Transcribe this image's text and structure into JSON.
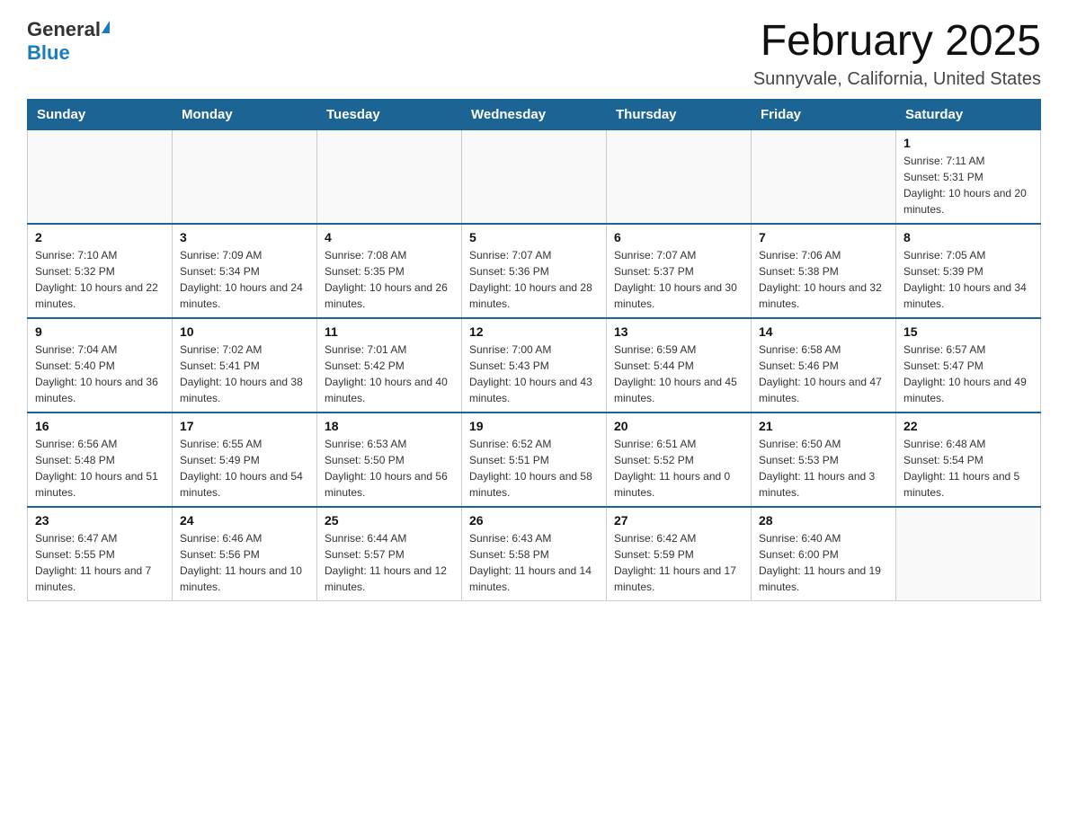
{
  "header": {
    "logo_general": "General",
    "logo_blue": "Blue",
    "month_title": "February 2025",
    "location": "Sunnyvale, California, United States"
  },
  "days_of_week": [
    "Sunday",
    "Monday",
    "Tuesday",
    "Wednesday",
    "Thursday",
    "Friday",
    "Saturday"
  ],
  "weeks": [
    [
      {
        "day": "",
        "info": ""
      },
      {
        "day": "",
        "info": ""
      },
      {
        "day": "",
        "info": ""
      },
      {
        "day": "",
        "info": ""
      },
      {
        "day": "",
        "info": ""
      },
      {
        "day": "",
        "info": ""
      },
      {
        "day": "1",
        "info": "Sunrise: 7:11 AM\nSunset: 5:31 PM\nDaylight: 10 hours and 20 minutes."
      }
    ],
    [
      {
        "day": "2",
        "info": "Sunrise: 7:10 AM\nSunset: 5:32 PM\nDaylight: 10 hours and 22 minutes."
      },
      {
        "day": "3",
        "info": "Sunrise: 7:09 AM\nSunset: 5:34 PM\nDaylight: 10 hours and 24 minutes."
      },
      {
        "day": "4",
        "info": "Sunrise: 7:08 AM\nSunset: 5:35 PM\nDaylight: 10 hours and 26 minutes."
      },
      {
        "day": "5",
        "info": "Sunrise: 7:07 AM\nSunset: 5:36 PM\nDaylight: 10 hours and 28 minutes."
      },
      {
        "day": "6",
        "info": "Sunrise: 7:07 AM\nSunset: 5:37 PM\nDaylight: 10 hours and 30 minutes."
      },
      {
        "day": "7",
        "info": "Sunrise: 7:06 AM\nSunset: 5:38 PM\nDaylight: 10 hours and 32 minutes."
      },
      {
        "day": "8",
        "info": "Sunrise: 7:05 AM\nSunset: 5:39 PM\nDaylight: 10 hours and 34 minutes."
      }
    ],
    [
      {
        "day": "9",
        "info": "Sunrise: 7:04 AM\nSunset: 5:40 PM\nDaylight: 10 hours and 36 minutes."
      },
      {
        "day": "10",
        "info": "Sunrise: 7:02 AM\nSunset: 5:41 PM\nDaylight: 10 hours and 38 minutes."
      },
      {
        "day": "11",
        "info": "Sunrise: 7:01 AM\nSunset: 5:42 PM\nDaylight: 10 hours and 40 minutes."
      },
      {
        "day": "12",
        "info": "Sunrise: 7:00 AM\nSunset: 5:43 PM\nDaylight: 10 hours and 43 minutes."
      },
      {
        "day": "13",
        "info": "Sunrise: 6:59 AM\nSunset: 5:44 PM\nDaylight: 10 hours and 45 minutes."
      },
      {
        "day": "14",
        "info": "Sunrise: 6:58 AM\nSunset: 5:46 PM\nDaylight: 10 hours and 47 minutes."
      },
      {
        "day": "15",
        "info": "Sunrise: 6:57 AM\nSunset: 5:47 PM\nDaylight: 10 hours and 49 minutes."
      }
    ],
    [
      {
        "day": "16",
        "info": "Sunrise: 6:56 AM\nSunset: 5:48 PM\nDaylight: 10 hours and 51 minutes."
      },
      {
        "day": "17",
        "info": "Sunrise: 6:55 AM\nSunset: 5:49 PM\nDaylight: 10 hours and 54 minutes."
      },
      {
        "day": "18",
        "info": "Sunrise: 6:53 AM\nSunset: 5:50 PM\nDaylight: 10 hours and 56 minutes."
      },
      {
        "day": "19",
        "info": "Sunrise: 6:52 AM\nSunset: 5:51 PM\nDaylight: 10 hours and 58 minutes."
      },
      {
        "day": "20",
        "info": "Sunrise: 6:51 AM\nSunset: 5:52 PM\nDaylight: 11 hours and 0 minutes."
      },
      {
        "day": "21",
        "info": "Sunrise: 6:50 AM\nSunset: 5:53 PM\nDaylight: 11 hours and 3 minutes."
      },
      {
        "day": "22",
        "info": "Sunrise: 6:48 AM\nSunset: 5:54 PM\nDaylight: 11 hours and 5 minutes."
      }
    ],
    [
      {
        "day": "23",
        "info": "Sunrise: 6:47 AM\nSunset: 5:55 PM\nDaylight: 11 hours and 7 minutes."
      },
      {
        "day": "24",
        "info": "Sunrise: 6:46 AM\nSunset: 5:56 PM\nDaylight: 11 hours and 10 minutes."
      },
      {
        "day": "25",
        "info": "Sunrise: 6:44 AM\nSunset: 5:57 PM\nDaylight: 11 hours and 12 minutes."
      },
      {
        "day": "26",
        "info": "Sunrise: 6:43 AM\nSunset: 5:58 PM\nDaylight: 11 hours and 14 minutes."
      },
      {
        "day": "27",
        "info": "Sunrise: 6:42 AM\nSunset: 5:59 PM\nDaylight: 11 hours and 17 minutes."
      },
      {
        "day": "28",
        "info": "Sunrise: 6:40 AM\nSunset: 6:00 PM\nDaylight: 11 hours and 19 minutes."
      },
      {
        "day": "",
        "info": ""
      }
    ]
  ]
}
